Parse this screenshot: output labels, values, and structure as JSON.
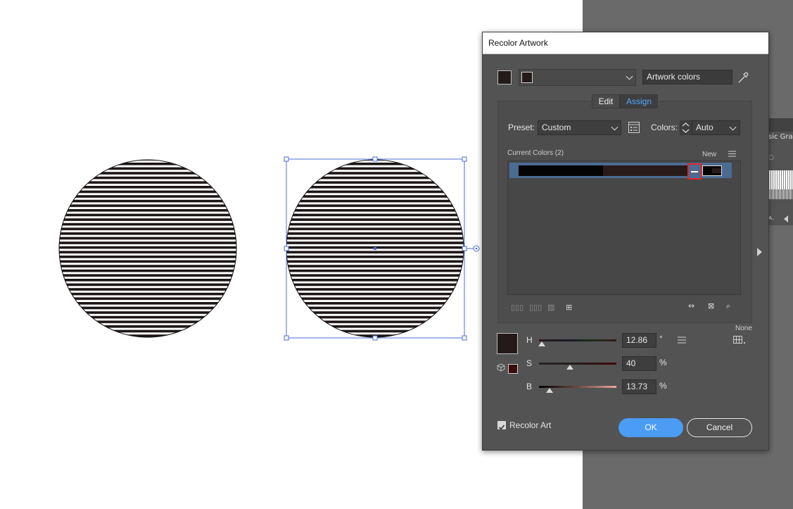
{
  "dialog": {
    "title": "Recolor Artwork",
    "artwork_colors_field": "Artwork colors",
    "tabs": {
      "edit": "Edit",
      "assign": "Assign"
    },
    "preset_label": "Preset:",
    "preset_value": "Custom",
    "colors_label": "Colors:",
    "colors_value": "Auto",
    "current_colors_label": "Current Colors (2)",
    "new_label": "New",
    "none_label": "None",
    "sliders": {
      "h": {
        "label": "H",
        "value": "12.86",
        "unit": "°"
      },
      "s": {
        "label": "S",
        "value": "40",
        "unit": "%"
      },
      "b": {
        "label": "B",
        "value": "13.73",
        "unit": "%"
      }
    },
    "recolor_art_label": "Recolor Art",
    "recolor_art_checked": true,
    "ok_label": "OK",
    "cancel_label": "Cancel"
  },
  "background_panel": {
    "tab_text": "sic Grap"
  },
  "colors": {
    "selection_blue": "#4c6b93",
    "accent_blue": "#52a7ff",
    "ok_button": "#4a9cf5",
    "highlight_red": "#e0262a",
    "current_color_1": "#050505",
    "current_color_2": "#2a1b1b",
    "stripe_dark": "#1d1515"
  }
}
